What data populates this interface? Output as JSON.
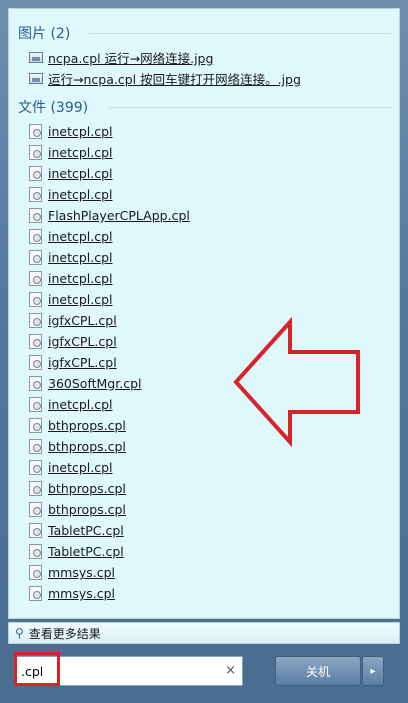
{
  "groups": {
    "pictures": {
      "header": "图片 (2)",
      "items": [
        "ncpa.cpl 运行→网络连接.jpg",
        "运行→ncpa.cpl 按回车键打开网络连接。.jpg"
      ]
    },
    "files": {
      "header": "文件 (399)",
      "items": [
        "inetcpl.cpl",
        "inetcpl.cpl",
        "inetcpl.cpl",
        "inetcpl.cpl",
        "FlashPlayerCPLApp.cpl",
        "inetcpl.cpl",
        "inetcpl.cpl",
        "inetcpl.cpl",
        "inetcpl.cpl",
        "igfxCPL.cpl",
        "igfxCPL.cpl",
        "igfxCPL.cpl",
        "360SoftMgr.cpl",
        "inetcpl.cpl",
        "bthprops.cpl",
        "bthprops.cpl",
        "inetcpl.cpl",
        "bthprops.cpl",
        "bthprops.cpl",
        "TabletPC.cpl",
        "TabletPC.cpl",
        "mmsys.cpl",
        "mmsys.cpl"
      ]
    }
  },
  "see_more": {
    "icon": "search-icon",
    "label": "查看更多结果"
  },
  "search": {
    "value": ".cpl",
    "clear_label": "×"
  },
  "shutdown": {
    "label": "关机",
    "arrow": "▸"
  },
  "annotation": {
    "arrow_color": "#d8232a",
    "highlight_color": "#d8232a"
  }
}
